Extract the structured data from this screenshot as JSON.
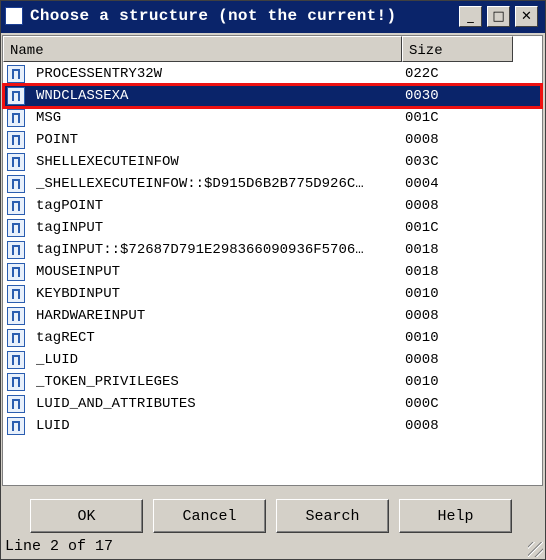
{
  "window": {
    "title": "Choose a structure (not the current!)",
    "controls": {
      "minimize": "_",
      "maximize": "□",
      "close": "✕"
    }
  },
  "columns": {
    "name": "Name",
    "size": "Size"
  },
  "rows": [
    {
      "name": "PROCESSENTRY32W",
      "size": "022C"
    },
    {
      "name": "WNDCLASSEXA",
      "size": "0030"
    },
    {
      "name": "MSG",
      "size": "001C"
    },
    {
      "name": "POINT",
      "size": "0008"
    },
    {
      "name": "SHELLEXECUTEINFOW",
      "size": "003C"
    },
    {
      "name": "_SHELLEXECUTEINFOW::$D915D6B2B775D926C…",
      "size": "0004"
    },
    {
      "name": "tagPOINT",
      "size": "0008"
    },
    {
      "name": "tagINPUT",
      "size": "001C"
    },
    {
      "name": "tagINPUT::$72687D791E298366090936F5706…",
      "size": "0018"
    },
    {
      "name": "MOUSEINPUT",
      "size": "0018"
    },
    {
      "name": "KEYBDINPUT",
      "size": "0010"
    },
    {
      "name": "HARDWAREINPUT",
      "size": "0008"
    },
    {
      "name": "tagRECT",
      "size": "0010"
    },
    {
      "name": "_LUID",
      "size": "0008"
    },
    {
      "name": "_TOKEN_PRIVILEGES",
      "size": "0010"
    },
    {
      "name": "LUID_AND_ATTRIBUTES",
      "size": "000C"
    },
    {
      "name": "LUID",
      "size": "0008"
    }
  ],
  "selected_row": 2,
  "buttons": {
    "ok": "OK",
    "cancel": "Cancel",
    "search": "Search",
    "help": "Help"
  },
  "status": "Line 2 of 17",
  "colors": {
    "title_bar": "#0a246a",
    "selection": "#0a246a",
    "face": "#d4d0c8",
    "highlight_box": "#ee1111"
  }
}
